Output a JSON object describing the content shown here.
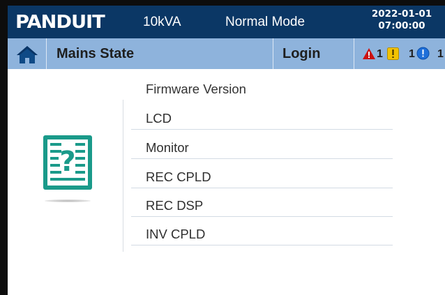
{
  "colors": {
    "header_bg": "#0b3765",
    "subbar_bg": "#8eb3dc",
    "accent_teal": "#1a9a8a",
    "alarm_red": "#cc1111",
    "warning_yellow": "#f2c200",
    "info_blue": "#1e6fd9"
  },
  "header": {
    "brand": "PANDUIT",
    "rating": "10kVA",
    "mode": "Normal Mode",
    "date": "2022-01-01",
    "time": "07:00:00"
  },
  "subbar": {
    "home_icon": "home-icon",
    "state_label": "Mains State",
    "login_label": "Login",
    "alarms": [
      {
        "icon": "alarm-triangle-icon",
        "count": "1"
      },
      {
        "icon": "warning-square-icon",
        "count": ""
      },
      {
        "icon": "info-circle-icon",
        "count": "1"
      },
      {
        "icon": "",
        "count": "1"
      }
    ]
  },
  "main": {
    "panel_icon": "help-document-icon",
    "section_title": "Firmware Version",
    "rows": [
      {
        "label": "LCD"
      },
      {
        "label": "Monitor"
      },
      {
        "label": "REC CPLD"
      },
      {
        "label": "REC DSP"
      },
      {
        "label": "INV CPLD"
      }
    ]
  }
}
